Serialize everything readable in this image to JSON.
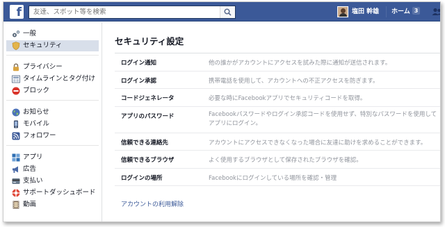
{
  "topbar": {
    "logo": "f",
    "search_placeholder": "友達、スポット等を検索",
    "user_name": "塩田 幹雄",
    "home_label": "ホーム",
    "home_badge": "3"
  },
  "sidebar": {
    "groups": [
      [
        {
          "label": "一般",
          "icon": "gears-icon"
        },
        {
          "label": "セキュリティ",
          "icon": "shield-icon",
          "active": true
        }
      ],
      [
        {
          "label": "プライバシー",
          "icon": "lock-icon"
        },
        {
          "label": "タイムラインとタグ付け",
          "icon": "timeline-icon"
        },
        {
          "label": "ブロック",
          "icon": "block-icon"
        }
      ],
      [
        {
          "label": "お知らせ",
          "icon": "globe-icon"
        },
        {
          "label": "モバイル",
          "icon": "mobile-icon"
        },
        {
          "label": "フォロワー",
          "icon": "rss-icon"
        }
      ],
      [
        {
          "label": "アプリ",
          "icon": "apps-icon"
        },
        {
          "label": "広告",
          "icon": "ads-icon"
        },
        {
          "label": "支払い",
          "icon": "payments-icon"
        },
        {
          "label": "サポートダッシュボード",
          "icon": "support-icon"
        },
        {
          "label": "動画",
          "icon": "video-icon"
        }
      ]
    ]
  },
  "main": {
    "title": "セキュリティ設定",
    "rows": [
      {
        "label": "ログイン通知",
        "desc": "他の誰かがアカウントにアクセスを試みた際に通知が送信されます。"
      },
      {
        "label": "ログイン承認",
        "desc": "携帯電話を使用して、アカウントへの不正アクセスを防ぎます。"
      },
      {
        "label": "コードジェネレータ",
        "desc": "必要な時にFacebookアプリでセキュリティコードを取得。"
      },
      {
        "label": "アプリのパスワード",
        "desc": "Facebookパスワードやログイン承認コードを使用せず、特別なパスワードを使用してアプリにログイン。"
      },
      {
        "label": "信頼できる連絡先",
        "desc": "アカウントにアクセスできなくなった場合に友達に助けを求めることができます。"
      },
      {
        "label": "信頼できるブラウザ",
        "desc": "よく使用するブラウザとして保存されたブラウザを確認。"
      },
      {
        "label": "ログインの場所",
        "desc": "Facebookにログインしている場所を確認・管理"
      }
    ],
    "deactivate_label": "アカウントの利用解除"
  },
  "colors": {
    "brand": "#3b5998",
    "active_nav": "#d8dfea",
    "desc_text": "#90949c"
  }
}
